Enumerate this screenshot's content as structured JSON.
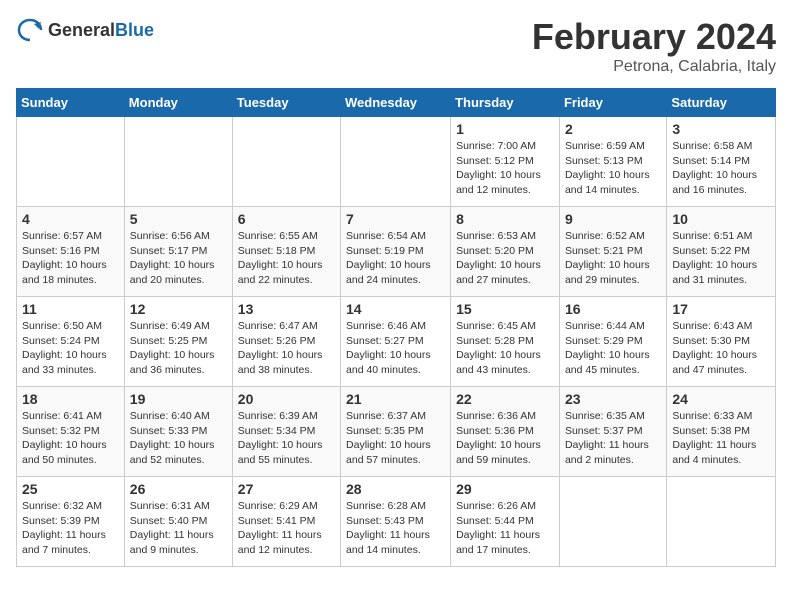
{
  "logo": {
    "general": "General",
    "blue": "Blue"
  },
  "header": {
    "month": "February 2024",
    "location": "Petrona, Calabria, Italy"
  },
  "days_of_week": [
    "Sunday",
    "Monday",
    "Tuesday",
    "Wednesday",
    "Thursday",
    "Friday",
    "Saturday"
  ],
  "weeks": [
    [
      {
        "day": "",
        "info": ""
      },
      {
        "day": "",
        "info": ""
      },
      {
        "day": "",
        "info": ""
      },
      {
        "day": "",
        "info": ""
      },
      {
        "day": "1",
        "info": "Sunrise: 7:00 AM\nSunset: 5:12 PM\nDaylight: 10 hours\nand 12 minutes."
      },
      {
        "day": "2",
        "info": "Sunrise: 6:59 AM\nSunset: 5:13 PM\nDaylight: 10 hours\nand 14 minutes."
      },
      {
        "day": "3",
        "info": "Sunrise: 6:58 AM\nSunset: 5:14 PM\nDaylight: 10 hours\nand 16 minutes."
      }
    ],
    [
      {
        "day": "4",
        "info": "Sunrise: 6:57 AM\nSunset: 5:16 PM\nDaylight: 10 hours\nand 18 minutes."
      },
      {
        "day": "5",
        "info": "Sunrise: 6:56 AM\nSunset: 5:17 PM\nDaylight: 10 hours\nand 20 minutes."
      },
      {
        "day": "6",
        "info": "Sunrise: 6:55 AM\nSunset: 5:18 PM\nDaylight: 10 hours\nand 22 minutes."
      },
      {
        "day": "7",
        "info": "Sunrise: 6:54 AM\nSunset: 5:19 PM\nDaylight: 10 hours\nand 24 minutes."
      },
      {
        "day": "8",
        "info": "Sunrise: 6:53 AM\nSunset: 5:20 PM\nDaylight: 10 hours\nand 27 minutes."
      },
      {
        "day": "9",
        "info": "Sunrise: 6:52 AM\nSunset: 5:21 PM\nDaylight: 10 hours\nand 29 minutes."
      },
      {
        "day": "10",
        "info": "Sunrise: 6:51 AM\nSunset: 5:22 PM\nDaylight: 10 hours\nand 31 minutes."
      }
    ],
    [
      {
        "day": "11",
        "info": "Sunrise: 6:50 AM\nSunset: 5:24 PM\nDaylight: 10 hours\nand 33 minutes."
      },
      {
        "day": "12",
        "info": "Sunrise: 6:49 AM\nSunset: 5:25 PM\nDaylight: 10 hours\nand 36 minutes."
      },
      {
        "day": "13",
        "info": "Sunrise: 6:47 AM\nSunset: 5:26 PM\nDaylight: 10 hours\nand 38 minutes."
      },
      {
        "day": "14",
        "info": "Sunrise: 6:46 AM\nSunset: 5:27 PM\nDaylight: 10 hours\nand 40 minutes."
      },
      {
        "day": "15",
        "info": "Sunrise: 6:45 AM\nSunset: 5:28 PM\nDaylight: 10 hours\nand 43 minutes."
      },
      {
        "day": "16",
        "info": "Sunrise: 6:44 AM\nSunset: 5:29 PM\nDaylight: 10 hours\nand 45 minutes."
      },
      {
        "day": "17",
        "info": "Sunrise: 6:43 AM\nSunset: 5:30 PM\nDaylight: 10 hours\nand 47 minutes."
      }
    ],
    [
      {
        "day": "18",
        "info": "Sunrise: 6:41 AM\nSunset: 5:32 PM\nDaylight: 10 hours\nand 50 minutes."
      },
      {
        "day": "19",
        "info": "Sunrise: 6:40 AM\nSunset: 5:33 PM\nDaylight: 10 hours\nand 52 minutes."
      },
      {
        "day": "20",
        "info": "Sunrise: 6:39 AM\nSunset: 5:34 PM\nDaylight: 10 hours\nand 55 minutes."
      },
      {
        "day": "21",
        "info": "Sunrise: 6:37 AM\nSunset: 5:35 PM\nDaylight: 10 hours\nand 57 minutes."
      },
      {
        "day": "22",
        "info": "Sunrise: 6:36 AM\nSunset: 5:36 PM\nDaylight: 10 hours\nand 59 minutes."
      },
      {
        "day": "23",
        "info": "Sunrise: 6:35 AM\nSunset: 5:37 PM\nDaylight: 11 hours\nand 2 minutes."
      },
      {
        "day": "24",
        "info": "Sunrise: 6:33 AM\nSunset: 5:38 PM\nDaylight: 11 hours\nand 4 minutes."
      }
    ],
    [
      {
        "day": "25",
        "info": "Sunrise: 6:32 AM\nSunset: 5:39 PM\nDaylight: 11 hours\nand 7 minutes."
      },
      {
        "day": "26",
        "info": "Sunrise: 6:31 AM\nSunset: 5:40 PM\nDaylight: 11 hours\nand 9 minutes."
      },
      {
        "day": "27",
        "info": "Sunrise: 6:29 AM\nSunset: 5:41 PM\nDaylight: 11 hours\nand 12 minutes."
      },
      {
        "day": "28",
        "info": "Sunrise: 6:28 AM\nSunset: 5:43 PM\nDaylight: 11 hours\nand 14 minutes."
      },
      {
        "day": "29",
        "info": "Sunrise: 6:26 AM\nSunset: 5:44 PM\nDaylight: 11 hours\nand 17 minutes."
      },
      {
        "day": "",
        "info": ""
      },
      {
        "day": "",
        "info": ""
      }
    ]
  ]
}
